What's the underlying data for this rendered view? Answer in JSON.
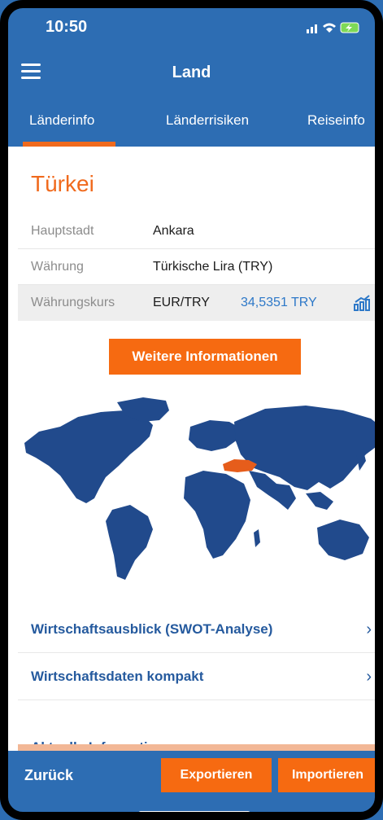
{
  "status": {
    "time": "10:50"
  },
  "nav": {
    "title": "Land"
  },
  "tabs": [
    "Länderinfo",
    "Länderrisiken",
    "Reiseinfo"
  ],
  "country": "Türkei",
  "info": [
    {
      "label": "Hauptstadt",
      "value": "Ankara"
    },
    {
      "label": "Währung",
      "value": "Türkische Lira (TRY)"
    }
  ],
  "exchange": {
    "label": "Währungskurs",
    "pair": "EUR/TRY",
    "rate": "34,5351 TRY"
  },
  "more_button": "Weitere Informationen",
  "links": [
    {
      "label": "Wirtschaftsausblick (SWOT-Analyse)"
    },
    {
      "label": "Wirtschaftsdaten kompakt"
    }
  ],
  "partial_link": "Aktuelle Informationen",
  "bottom": {
    "back": "Zurück",
    "export": "Exportieren",
    "import": "Importieren"
  },
  "colors": {
    "primary": "#2d6db3",
    "accent": "#f66a11",
    "map_land": "#214a8c",
    "highlight_country": "#e65d1b"
  }
}
